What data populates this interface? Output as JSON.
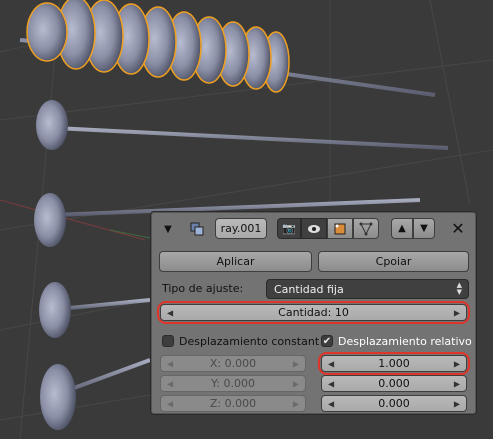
{
  "panel": {
    "header": {
      "object_name": "ray.001",
      "icons": [
        "triangle-down-icon",
        "modifier-wrench-icon",
        "camera-render-icon",
        "eye-icon",
        "editmode-icon",
        "cage-vertices-icon",
        "move-up-icon",
        "move-down-icon",
        "close-icon"
      ]
    },
    "apply_label": "Aplicar",
    "copy_label": "Cpoiar",
    "fit_type": {
      "label": "Tipo de ajuste:",
      "value": "Cantidad fija"
    },
    "count": {
      "label": "Cantidad:",
      "value": "10"
    },
    "constant_offset": {
      "label": "Desplazamiento constant",
      "checked": false
    },
    "relative_offset": {
      "label": "Desplazamiento relativo",
      "checked": true
    },
    "constant_fields": [
      {
        "label": "X:",
        "value": "0.000"
      },
      {
        "label": "Y:",
        "value": "0.000"
      },
      {
        "label": "Z:",
        "value": "0.000"
      }
    ],
    "relative_fields": [
      "1.000",
      "0.000",
      "0.000"
    ]
  },
  "colors": {
    "viewport_bg": "#3a3a3a",
    "panel_bg": "#737373",
    "highlight_red": "#e0342a",
    "selection_orange": "#f0a020"
  }
}
